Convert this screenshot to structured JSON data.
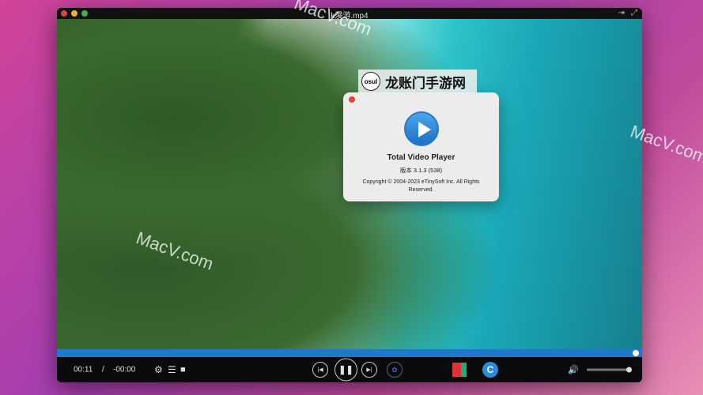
{
  "window": {
    "title": "k漫游.mp4"
  },
  "watermarks": [
    "MacV.com",
    "MacV.com",
    "MacV.com"
  ],
  "overlay_badge": {
    "logo": "osul",
    "text": "龙账门手游网"
  },
  "about": {
    "app_name": "Total Video Player",
    "version": "版本 3.1.3 (538)",
    "copyright": "Copyright © 2004-2023 eTinySoft Inc. All Rights Reserved."
  },
  "player": {
    "elapsed": "00:11",
    "separator": "/",
    "remaining": "-00:00",
    "progress": 0.99,
    "volume": 0.9
  },
  "colors": {
    "progress": "#1e7ac8",
    "close": "#e0443e",
    "minimize": "#e9b130",
    "zoom": "#3fb34a"
  }
}
